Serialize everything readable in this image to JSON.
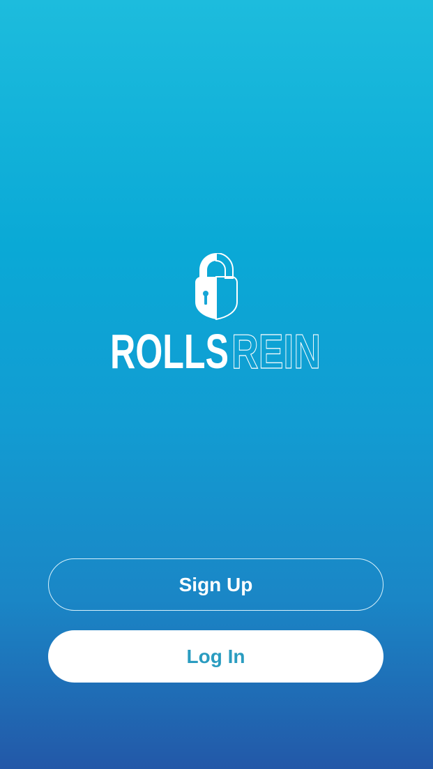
{
  "brand": {
    "name_primary": "ROLLS",
    "name_secondary": "REIN",
    "icon": "lock-icon",
    "colors": {
      "filled": "#ffffff",
      "outline": "#ffffff"
    }
  },
  "actions": {
    "signup_label": "Sign Up",
    "login_label": "Log In"
  },
  "colors": {
    "gradient_top": "#1dbcdd",
    "gradient_bottom": "#2358a8",
    "login_text": "#2a9cc0"
  }
}
